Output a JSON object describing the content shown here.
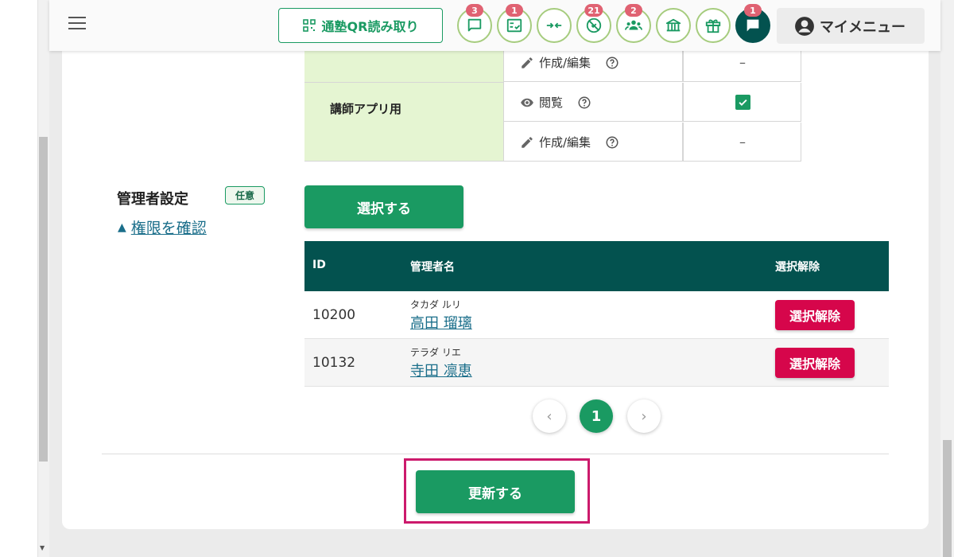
{
  "header": {
    "qr_button_label": "通塾QR読み取り",
    "icons": [
      {
        "name": "message-icon",
        "badge": "3"
      },
      {
        "name": "checklist-icon",
        "badge": "1"
      },
      {
        "name": "merge-arrows-icon",
        "badge": ""
      },
      {
        "name": "no-entry-icon",
        "badge": "21"
      },
      {
        "name": "group-icon",
        "badge": "2"
      },
      {
        "name": "school-icon",
        "badge": ""
      },
      {
        "name": "gift-icon",
        "badge": ""
      },
      {
        "name": "chat-icon",
        "badge": "1"
      }
    ],
    "my_menu_label": "マイメニュー"
  },
  "permissions": {
    "section_label": "講師アプリ用",
    "rows": [
      {
        "label": "作成/編集",
        "icon": "pencil-icon",
        "value": "–"
      },
      {
        "label": "閲覧",
        "icon": "eye-icon",
        "value": "checked"
      },
      {
        "label": "作成/編集",
        "icon": "pencil-icon",
        "value": "–"
      }
    ]
  },
  "admin": {
    "title": "管理者設定",
    "optional_badge": "任意",
    "permission_link": "権限を確認",
    "select_button": "選択する",
    "table": {
      "headers": {
        "id": "ID",
        "name": "管理者名",
        "unselect": "選択解除"
      },
      "rows": [
        {
          "id": "10200",
          "kana": "タカダ ルリ",
          "name": "高田 瑠璃",
          "unselect": "選択解除"
        },
        {
          "id": "10132",
          "kana": "テラダ リエ",
          "name": "寺田 凛恵",
          "unselect": "選択解除"
        }
      ]
    },
    "pagination": {
      "current": "1",
      "prev": "‹",
      "next": "›"
    }
  },
  "footer": {
    "update_button": "更新する"
  },
  "colors": {
    "primary": "#1a9a62",
    "dark_teal": "#03524f",
    "danger": "#d6064b",
    "highlight": "#cc1a6c",
    "badge": "#e06272"
  }
}
